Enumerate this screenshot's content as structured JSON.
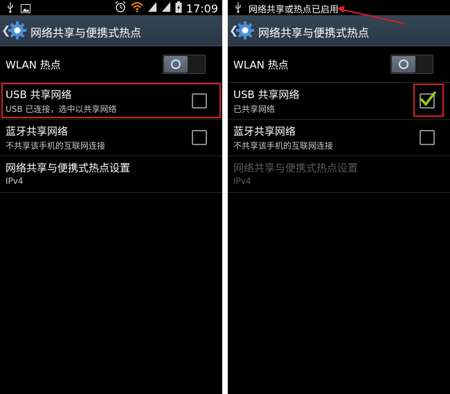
{
  "colors": {
    "highlight": "#d81e28",
    "check": "#8ecf1e",
    "actionbar": "#2f3e4d"
  },
  "left": {
    "status": {
      "time": "17:09",
      "icons": [
        "usb-icon",
        "image-icon",
        "alarm-icon",
        "wifi-icon",
        "signal-icon",
        "signal-icon",
        "battery-icon"
      ]
    },
    "title": "网络共享与便携式热点",
    "wlan": {
      "label": "WLAN 热点",
      "on": false
    },
    "usb": {
      "title": "USB 共享网络",
      "subtitle": "USB 已连接，选中以共享网络",
      "checked": false
    },
    "bt": {
      "title": "蓝牙共享网络",
      "subtitle": "不共享该手机的互联网连接",
      "checked": false
    },
    "settings": {
      "title": "网络共享与便携式热点设置",
      "subtitle": "IPv4",
      "enabled": true
    }
  },
  "right": {
    "status": {
      "notification": "网络共享或热点已启用",
      "icons": [
        "usb-icon"
      ]
    },
    "title": "网络共享与便携式热点",
    "wlan": {
      "label": "WLAN 热点",
      "on": false
    },
    "usb": {
      "title": "USB 共享网络",
      "subtitle": "已共享网络",
      "checked": true
    },
    "bt": {
      "title": "蓝牙共享网络",
      "subtitle": "不共享该手机的互联网连接",
      "checked": false
    },
    "settings": {
      "title": "网络共享与便携式热点设置",
      "subtitle": "IPv4",
      "enabled": false
    }
  }
}
